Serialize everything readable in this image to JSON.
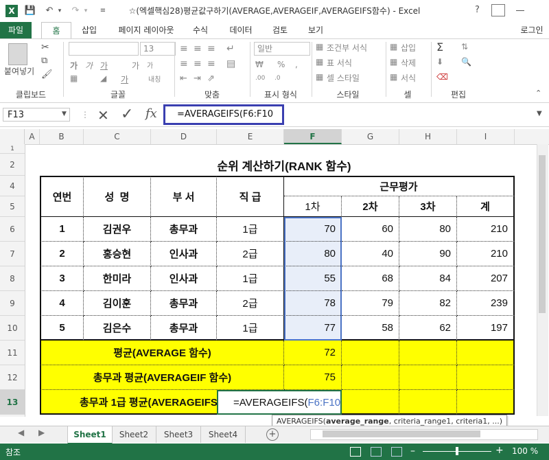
{
  "window": {
    "title": "☆(엑셀핵심28)평균값구하기(AVERAGE,AVERAGEIF,AVERAGEIFS함수) - Excel",
    "help": "?"
  },
  "ribbon_tabs": [
    "파일",
    "홈",
    "삽입",
    "페이지 레이아웃",
    "수식",
    "데이터",
    "검토",
    "보기"
  ],
  "login": "로그인",
  "ribbon": {
    "groups": [
      "클립보드",
      "글꼴",
      "맞춤",
      "표시 형식",
      "스타일",
      "셀",
      "편집"
    ],
    "paste": "붙여넣기",
    "font_size": "13",
    "number_format": "일반",
    "cond_format": "조건부 서식",
    "table_format": "표 서식",
    "cell_style": "셀 스타일",
    "insert": "삽입",
    "delete": "삭제",
    "format": "서식",
    "wrap": "내칭"
  },
  "formula_bar": {
    "name_box": "F13",
    "formula": "=AVERAGEIFS(F6:F10"
  },
  "columns": [
    "A",
    "B",
    "C",
    "D",
    "E",
    "F",
    "G",
    "H",
    "I"
  ],
  "rows": [
    "1",
    "2",
    "4",
    "5",
    "6",
    "7",
    "8",
    "9",
    "10",
    "11",
    "12",
    "13"
  ],
  "sheet": {
    "title": "순위 계산하기(RANK 함수)",
    "headers": {
      "no": "연번",
      "name": "성  명",
      "dept": "부 서",
      "grade": "직 급",
      "eval": "근무평가",
      "first": "1차",
      "second": "2차",
      "third": "3차",
      "total": "계"
    },
    "records": [
      {
        "no": "1",
        "name": "김권우",
        "dept": "총무과",
        "grade": "1급",
        "v1": "70",
        "v2": "60",
        "v3": "80",
        "total": "210"
      },
      {
        "no": "2",
        "name": "홍승현",
        "dept": "인사과",
        "grade": "2급",
        "v1": "80",
        "v2": "40",
        "v3": "90",
        "total": "210"
      },
      {
        "no": "3",
        "name": "한미라",
        "dept": "인사과",
        "grade": "1급",
        "v1": "55",
        "v2": "68",
        "v3": "84",
        "total": "207"
      },
      {
        "no": "4",
        "name": "김이훈",
        "dept": "총무과",
        "grade": "2급",
        "v1": "78",
        "v2": "79",
        "v3": "82",
        "total": "239"
      },
      {
        "no": "5",
        "name": "김은수",
        "dept": "총무과",
        "grade": "1급",
        "v1": "77",
        "v2": "58",
        "v3": "62",
        "total": "197"
      }
    ],
    "summary": [
      {
        "label": "평균(AVERAGE 함수)",
        "value": "72"
      },
      {
        "label": "총무과 평균(AVERAGEIF 함수)",
        "value": "75"
      },
      {
        "label": "총무과 1급 평균(AVERAGEIFS",
        "value": ""
      }
    ],
    "editing_prefix": "=AVERAGEIFS(",
    "editing_ref": "F6:F10",
    "tooltip_fn": "AVERAGEIFS(",
    "tooltip_bold": "average_range",
    "tooltip_rest": ", criteria_range1, criteria1, ...)"
  },
  "sheet_tabs": [
    "Sheet1",
    "Sheet2",
    "Sheet3",
    "Sheet4"
  ],
  "status": {
    "mode": "참조",
    "zoom": "100 %"
  },
  "colors": {
    "excel_green": "#217346",
    "summary_yellow": "#ffff00",
    "selection_fill": "#e8eef9",
    "formula_highlight": "#3a3fb0"
  }
}
